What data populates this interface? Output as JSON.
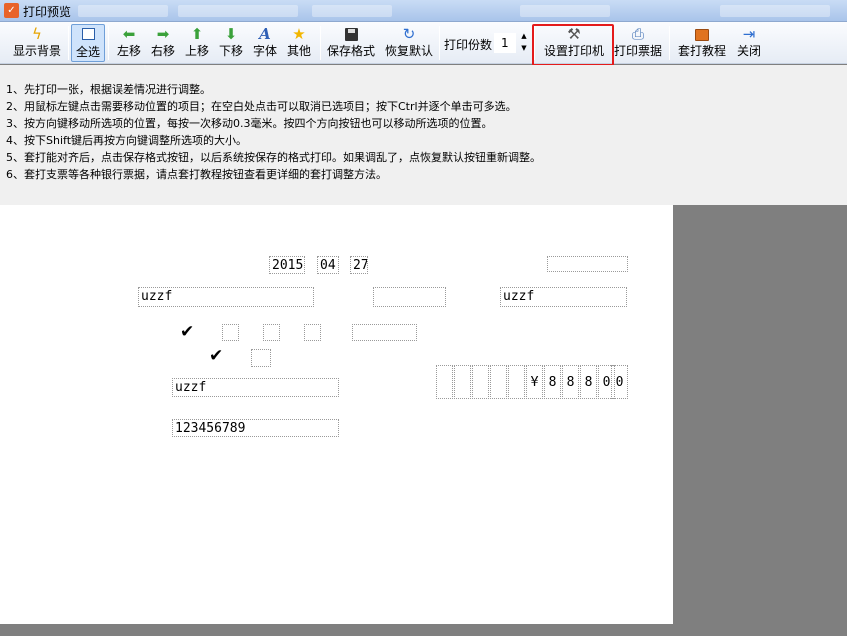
{
  "window": {
    "title": "打印预览"
  },
  "toolbar": {
    "buttons": [
      {
        "id": "show-bg",
        "label": "显示背景",
        "icon": "lightning-icon"
      },
      {
        "id": "select-all",
        "label": "全选",
        "icon": "select-all-icon"
      },
      {
        "id": "move-left",
        "label": "左移",
        "icon": "arrow-left-icon"
      },
      {
        "id": "move-right",
        "label": "右移",
        "icon": "arrow-right-icon"
      },
      {
        "id": "move-up",
        "label": "上移",
        "icon": "arrow-up-icon"
      },
      {
        "id": "move-down",
        "label": "下移",
        "icon": "arrow-down-icon"
      },
      {
        "id": "font",
        "label": "字体",
        "icon": "font-icon"
      },
      {
        "id": "other",
        "label": "其他",
        "icon": "star-icon"
      },
      {
        "id": "save-format",
        "label": "保存格式",
        "icon": "floppy-icon"
      },
      {
        "id": "restore-default",
        "label": "恢复默认",
        "icon": "refresh-icon"
      },
      {
        "id": "printer-setup",
        "label": "设置打印机",
        "icon": "tools-icon"
      },
      {
        "id": "print-receipt",
        "label": "打印票据",
        "icon": "printer-icon"
      },
      {
        "id": "tutorial",
        "label": "套打教程",
        "icon": "book-icon"
      },
      {
        "id": "close",
        "label": "关闭",
        "icon": "exit-icon"
      }
    ],
    "copies_label": "打印份数",
    "copies_value": "1"
  },
  "instructions": [
    "1、先打印一张，根据误差情况进行调整。",
    "2、用鼠标左键点击需要移动位置的项目；在空白处点击可以取消已选项目；按下Ctrl并逐个单击可多选。",
    "3、按方向键移动所选项的位置，每按一次移动0.3毫米。按四个方向按钮也可以移动所选项的位置。",
    "4、按下Shift键后再按方向键调整所选项的大小。",
    "5、套打能对齐后，点击保存格式按钮，以后系统按保存的格式打印。如果调乱了，点恢复默认按钮重新调整。",
    "6、套打支票等各种银行票据，请点套打教程按钮查看更详细的套打调整方法。"
  ],
  "check_form": {
    "year": "2015",
    "month": "04",
    "day": "27",
    "payee": "uzzf",
    "payee_right": "uzzf",
    "name_field": "uzzf",
    "account": "123456789",
    "amount_digits": [
      "",
      "",
      "",
      "",
      "",
      "¥",
      "8",
      "8",
      "8",
      "0",
      "0"
    ],
    "check_mark": "✔"
  },
  "colors": {
    "highlight": "#e41b1b",
    "accent": "#e8632a"
  }
}
